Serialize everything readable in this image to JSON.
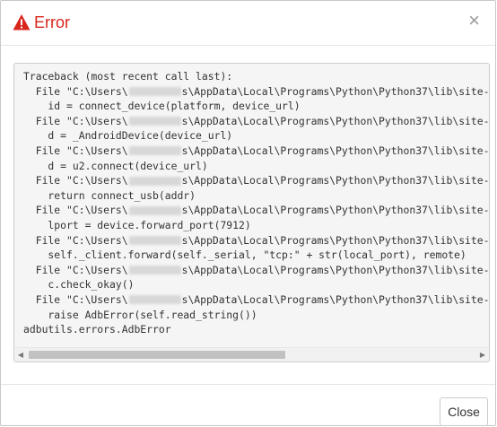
{
  "dialog": {
    "title": "Error",
    "close_glyph": "×",
    "close_button_label": "Close",
    "accent_color": "#d9261c"
  },
  "traceback": {
    "lines": [
      {
        "text": "Traceback (most recent call last):"
      },
      {
        "pre": "  File \"C:\\Users\\",
        "post": "s\\AppData\\Local\\Programs\\Python\\Python37\\lib\\site-pac"
      },
      {
        "text": "    id = connect_device(platform, device_url)"
      },
      {
        "pre": "  File \"C:\\Users\\",
        "post": "s\\AppData\\Local\\Programs\\Python\\Python37\\lib\\site-pac"
      },
      {
        "text": "    d = _AndroidDevice(device_url)"
      },
      {
        "pre": "  File \"C:\\Users\\",
        "post": "s\\AppData\\Local\\Programs\\Python\\Python37\\lib\\site-pac"
      },
      {
        "text": "    d = u2.connect(device_url)"
      },
      {
        "pre": "  File \"C:\\Users\\",
        "post": "s\\AppData\\Local\\Programs\\Python\\Python37\\lib\\site-pac"
      },
      {
        "text": "    return connect_usb(addr)"
      },
      {
        "pre": "  File \"C:\\Users\\",
        "post": "s\\AppData\\Local\\Programs\\Python\\Python37\\lib\\site-pac"
      },
      {
        "text": "    lport = device.forward_port(7912)"
      },
      {
        "pre": "  File \"C:\\Users\\",
        "post": "s\\AppData\\Local\\Programs\\Python\\Python37\\lib\\site-pac"
      },
      {
        "text": "    self._client.forward(self._serial, \"tcp:\" + str(local_port), remote)"
      },
      {
        "pre": "  File \"C:\\Users\\",
        "post": "s\\AppData\\Local\\Programs\\Python\\Python37\\lib\\site-pac"
      },
      {
        "text": "    c.check_okay()"
      },
      {
        "pre": "  File \"C:\\Users\\",
        "post": "s\\AppData\\Local\\Programs\\Python\\Python37\\lib\\site-pac"
      },
      {
        "text": "    raise AdbError(self.read_string())"
      },
      {
        "text": "adbutils.errors.AdbError"
      }
    ]
  },
  "scrollbar": {
    "left_arrow": "◀",
    "right_arrow": "▶"
  }
}
